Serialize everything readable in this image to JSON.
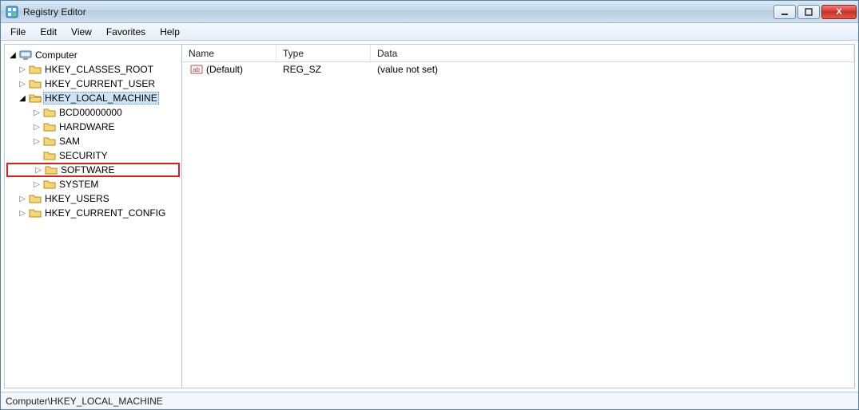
{
  "title": "Registry Editor",
  "menu": [
    "File",
    "Edit",
    "View",
    "Favorites",
    "Help"
  ],
  "tree": {
    "root_label": "Computer",
    "hives": [
      {
        "label": "HKEY_CLASSES_ROOT",
        "expanded": false,
        "selected": false,
        "children": []
      },
      {
        "label": "HKEY_CURRENT_USER",
        "expanded": false,
        "selected": false,
        "children": []
      },
      {
        "label": "HKEY_LOCAL_MACHINE",
        "expanded": true,
        "selected": true,
        "children": [
          {
            "label": "BCD00000000",
            "highlight": false
          },
          {
            "label": "HARDWARE",
            "highlight": false
          },
          {
            "label": "SAM",
            "highlight": false
          },
          {
            "label": "SECURITY",
            "highlight": false
          },
          {
            "label": "SOFTWARE",
            "highlight": true
          },
          {
            "label": "SYSTEM",
            "highlight": false
          }
        ]
      },
      {
        "label": "HKEY_USERS",
        "expanded": false,
        "selected": false,
        "children": []
      },
      {
        "label": "HKEY_CURRENT_CONFIG",
        "expanded": false,
        "selected": false,
        "children": []
      }
    ]
  },
  "list": {
    "columns": {
      "name": "Name",
      "type": "Type",
      "data": "Data"
    },
    "rows": [
      {
        "name": "(Default)",
        "type": "REG_SZ",
        "data": "(value not set)"
      }
    ]
  },
  "status": "Computer\\HKEY_LOCAL_MACHINE",
  "window_controls": {
    "minimize": "–",
    "maximize": "❐",
    "close": "X"
  }
}
